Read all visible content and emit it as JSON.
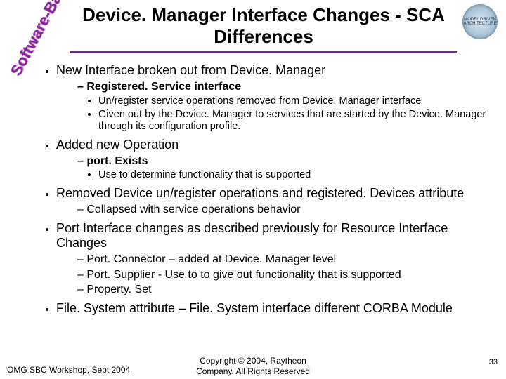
{
  "title": "Device. Manager Interface Changes - SCA Differences",
  "badgeLeft": "Software-Based",
  "badgeRight": "MODEL DRIVEN ARCHITECTURE",
  "bullets": [
    {
      "text": "New Interface broken out from Device. Manager",
      "children": [
        {
          "text": "Registered. Service interface",
          "bold": true,
          "children": [
            {
              "text": "Un/register service operations removed from Device. Manager interface"
            },
            {
              "text": "Given out by the Device. Manager to services that are started by the Device. Manager through its configuration profile."
            }
          ]
        }
      ]
    },
    {
      "text": "Added new Operation",
      "children": [
        {
          "text": "port. Exists",
          "bold": true,
          "children": [
            {
              "text": "Use to determine functionality that is supported"
            }
          ]
        }
      ]
    },
    {
      "text": "Removed Device un/register operations and registered. Devices attribute",
      "children": [
        {
          "text": "Collapsed with service operations behavior",
          "bold": false
        }
      ]
    },
    {
      "text": "Port Interface changes as described previously for Resource Interface Changes",
      "children": [
        {
          "text": "Port. Connector – added at Device. Manager level",
          "bold": false
        },
        {
          "text": "Port. Supplier - Use to to give out functionality that is supported",
          "bold": false
        },
        {
          "text": "Property. Set",
          "bold": false
        }
      ]
    },
    {
      "text": "File. System attribute – File. System interface different CORBA Module"
    }
  ],
  "footer": {
    "left": "OMG SBC Workshop, Sept 2004",
    "centerLine1": "Copyright © 2004, Raytheon",
    "centerLine2": "Company. All Rights Reserved",
    "right": "33"
  }
}
